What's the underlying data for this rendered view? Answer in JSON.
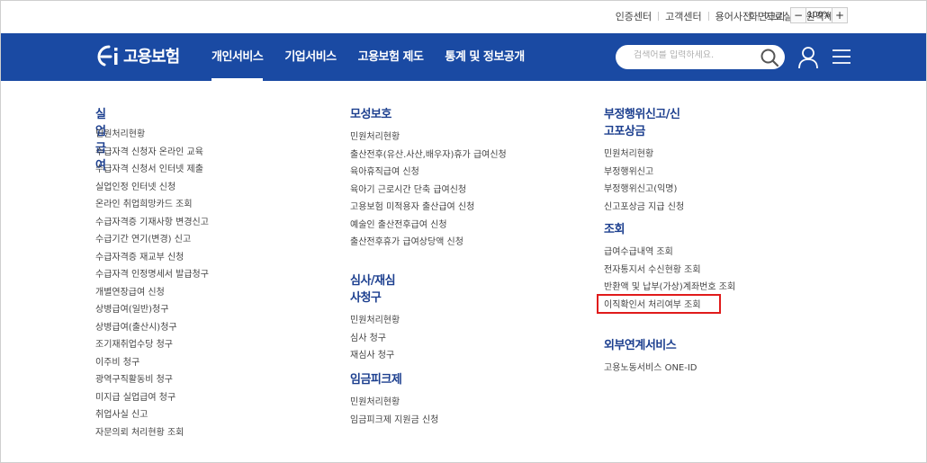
{
  "utility": {
    "links": [
      "인증센터",
      "고객센터",
      "용어사전",
      "자료실",
      "원격제어"
    ],
    "font_size_label": "화면크기",
    "zoom_minus": "−",
    "zoom_value": "100%",
    "zoom_plus": "+"
  },
  "header": {
    "logo_text": "고용보험",
    "nav": [
      "개인서비스",
      "기업서비스",
      "고용보험 제도",
      "통계 및 정보공개"
    ],
    "active_nav_index": 0,
    "search_placeholder": "검색어를 입력하세요.",
    "background_color": "#1a4aa3"
  },
  "menu": {
    "col1": {
      "title": "실업급여",
      "items": [
        "민원처리현황",
        "수급자격 신청자 온라인 교육",
        "수급자격 신청서 인터넷 제출",
        "실업인정 인터넷 신청",
        "온라인 취업희망카드 조회",
        "수급자격증 기재사항 변경신고",
        "수급기간 연기(변경) 신고",
        "수급자격증 재교부 신청",
        "수급자격 인정명세서 발급청구",
        "개별연장급여 신청",
        "상병급여(일반)청구",
        "상병급여(출산시)청구",
        "조기재취업수당 청구",
        "이주비 청구",
        "광역구직활동비 청구",
        "미지급 실업급여 청구",
        "취업사실 신고",
        "자문의뢰 처리현황 조회"
      ]
    },
    "col2": {
      "sections": [
        {
          "title": "모성보호",
          "items": [
            "민원처리현황",
            "출산전후(유산.사산,배우자)휴가 급여신청",
            "육아휴직급여 신청",
            "육아기 근로시간 단축 급여신청",
            "고용보험 미적용자 출산급여 신청",
            "예술인 출산전후급여 신청",
            "출산전후휴가 급여상당액 신청"
          ]
        },
        {
          "title": "심사/재심사청구",
          "items": [
            "민원처리현황",
            "심사 청구",
            "재심사 청구"
          ]
        },
        {
          "title": "임금피크제",
          "items": [
            "민원처리현황",
            "임금피크제 지원금 신청"
          ]
        }
      ]
    },
    "col3": {
      "sections": [
        {
          "title": "부정행위신고/신고포상금",
          "items": [
            "민원처리현황",
            "부정행위신고",
            "부정행위신고(익명)",
            "신고포상금 지급 신청"
          ]
        },
        {
          "title": "조회",
          "items": [
            "급여수급내역 조회",
            "전자통지서 수신현황 조회",
            "반환액 및 납부(가상)계좌번호 조회",
            "이직확인서 처리여부 조회"
          ]
        },
        {
          "title": "외부연계서비스",
          "items": [
            "고용노동서비스 ONE-ID"
          ]
        }
      ]
    },
    "highlight_color": "#e01b1b"
  }
}
